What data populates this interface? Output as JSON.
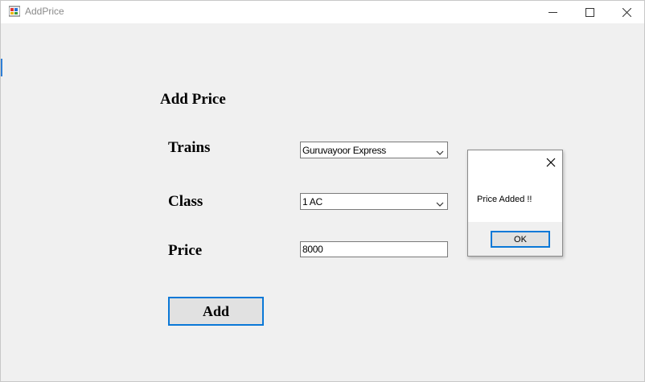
{
  "window": {
    "title": "AddPrice",
    "icons": {
      "app": "app-window-icon",
      "minimize": "minimize-icon",
      "maximize": "maximize-icon",
      "close": "close-icon"
    }
  },
  "form": {
    "heading": "Add Price",
    "trains_label": "Trains",
    "trains_value": "Guruvayoor Express",
    "class_label": "Class",
    "class_value": "1 AC",
    "price_label": "Price",
    "price_value": "8000",
    "add_label": "Add"
  },
  "dialog": {
    "message": "Price Added !!",
    "ok_label": "OK"
  },
  "colors": {
    "accent": "#0a78d7",
    "background": "#f0f0f0",
    "button": "#e1e1e1"
  }
}
